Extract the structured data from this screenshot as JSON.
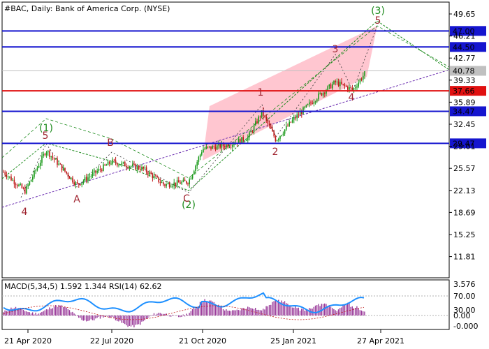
{
  "header": {
    "title": "#BAC, Daily:  Bank of America Corp. (NYSE)"
  },
  "indicator": {
    "title": "MACD(5,34,5) 1.592 1.344 RSI(14) 62.62",
    "axis_labels": [
      "3.576",
      "70.00",
      "0.00",
      "30.00",
      "-0.000"
    ]
  },
  "chart_data": {
    "type": "candlestick",
    "title": "#BAC, Daily:  Bank of America Corp. (NYSE)",
    "ylim": [
      8.5,
      51.5
    ],
    "y_ticks": [
      "49.65",
      "46.21",
      "42.77",
      "39.33",
      "35.89",
      "32.45",
      "29.01",
      "25.57",
      "22.13",
      "18.69",
      "15.25",
      "11.81"
    ],
    "x_ticks": [
      "21 Apr 2020",
      "22 Jul 2020",
      "21 Oct 2020",
      "25 Jan 2021",
      "27 Apr 2021"
    ],
    "current_price": "40.78",
    "levels": [
      {
        "value": 47.0,
        "label": "47.00",
        "color": "#1515cf"
      },
      {
        "value": 44.5,
        "label": "44.50",
        "color": "#1515cf"
      },
      {
        "value": 37.66,
        "label": "37.66",
        "color": "#e01010"
      },
      {
        "value": 34.47,
        "label": "34.47",
        "color": "#1515cf"
      },
      {
        "value": 29.47,
        "label": "29.47",
        "color": "#1515cf"
      }
    ],
    "wave_labels": [
      {
        "text": "(1)",
        "color": "#1a8a1a"
      },
      {
        "text": "(2)",
        "color": "#1a8a1a"
      },
      {
        "text": "(3)",
        "color": "#1a8a1a"
      },
      {
        "text": "5",
        "color": "#a02530"
      },
      {
        "text": "4",
        "color": "#a02530"
      },
      {
        "text": "A",
        "color": "#a02530"
      },
      {
        "text": "B",
        "color": "#a02530"
      },
      {
        "text": "C",
        "color": "#a02530"
      },
      {
        "text": "1",
        "color": "#a02530"
      },
      {
        "text": "2",
        "color": "#a02530"
      },
      {
        "text": "3",
        "color": "#a02530"
      },
      {
        "text": "4",
        "color": "#a02530"
      },
      {
        "text": "5",
        "color": "#a02530"
      }
    ],
    "colors": {
      "bull_candle": "#1a9a1a",
      "bear_candle": "#c01818",
      "channel_fill": "#ffc0cb",
      "trendline": "#6a2cb0",
      "wave_green": "#1a8a1a",
      "wave_red": "#a02530",
      "macd_hist": "#9b3c9b",
      "rsi_line": "#1e90ff",
      "signal_line": "#c01818"
    }
  }
}
